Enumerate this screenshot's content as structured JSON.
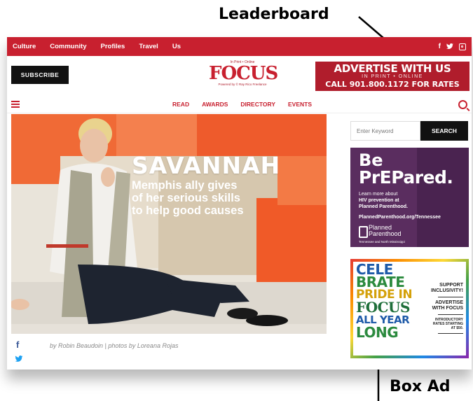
{
  "callouts": {
    "leaderboard": "Leaderboard",
    "box_ad": "Box Ad"
  },
  "topnav": {
    "items": [
      "Culture",
      "Community",
      "Profiles",
      "Travel",
      "Us"
    ],
    "social": [
      "f",
      "t",
      "ig"
    ]
  },
  "header": {
    "subscribe_label": "SUBSCRIBE",
    "logo": {
      "top_text": "In Print • Online",
      "word": "FOCUS",
      "tagline": "Powered by © Ray Rico Freelance"
    },
    "leaderboard_ad": {
      "line1": "ADVERTISE WITH US",
      "line2": "IN PRINT • ONLINE",
      "line3": "CALL 901.800.1172 FOR RATES"
    }
  },
  "mainnav": {
    "items": [
      "READ",
      "AWARDS",
      "DIRECTORY",
      "EVENTS"
    ]
  },
  "hero": {
    "title": "SAVANNAH",
    "subtitle_lines": [
      "Memphis ally gives",
      "of her serious skills",
      "to help good causes"
    ],
    "byline": "by Robin Beaudoin | photos by Loreana Rojas"
  },
  "share": {
    "facebook": "f",
    "twitter": "🐦"
  },
  "search": {
    "placeholder": "Enter Keyword",
    "button_label": "SEARCH"
  },
  "ad_planned_parenthood": {
    "line1": "Be",
    "line2": "PrEPared.",
    "learn": "Learn more about",
    "hiv": "HIV prevention at",
    "pp": "Planned Parenthood.",
    "url": "PlannedParenthood.org/Tennessee",
    "brand1": "Planned",
    "brand2": "Parenthood",
    "region": "Tennessee and North Mississippi"
  },
  "ad_pride": {
    "lines": [
      "CELE",
      "BRATE",
      "PRIDE IN",
      "FOCUS",
      "ALL YEAR",
      "LONG"
    ],
    "support": [
      "SUPPORT",
      "INCLUSIVITY!"
    ],
    "advertise": [
      "ADVERTISE",
      "WITH FOCUS"
    ],
    "rates": [
      "INTRODUCTORY",
      "RATES STARTING",
      "AT $50."
    ]
  },
  "colors": {
    "brand_red": "#c8202f",
    "ad_purple": "#5a2d5f",
    "hero_orange": "#ee5b2c"
  }
}
